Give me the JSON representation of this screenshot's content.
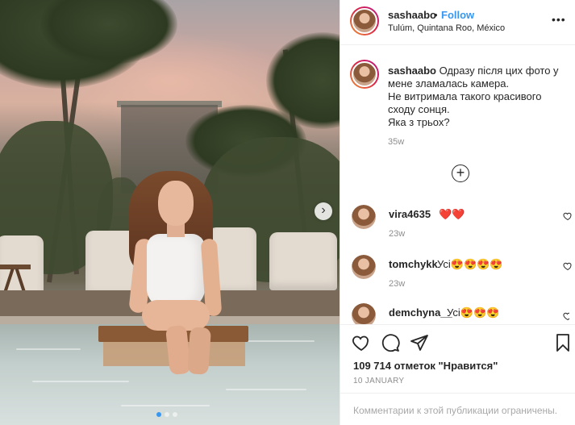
{
  "post": {
    "username": "sashaabo",
    "separator": "•",
    "follow_label": "Follow",
    "location": "Tulúm, Quintana Roo, México",
    "more_label": "•••"
  },
  "caption": {
    "username": "sashaabo",
    "lines": [
      "Одразу після цих фото у",
      "мене зламалась камера.",
      "Не витримала такого красивого",
      "сходу сонця.",
      "Яка з трьох?"
    ],
    "time": "35w",
    "load_more_label": "+"
  },
  "comments": [
    {
      "username": "vira4635",
      "text": "❤️❤️",
      "time": "23w"
    },
    {
      "username": "tomchykk",
      "text": "Усі😍😍😍😍",
      "time": "23w"
    },
    {
      "username": "demchyna__",
      "text": "Усі😍😍😍",
      "time": ""
    }
  ],
  "actions": {
    "likes": "109 714 отметок \"Нравится\"",
    "date": "10 JANUARY",
    "comments_disabled": "Комментарии к этой публикации ограничены."
  },
  "carousel": {
    "next_label": "›",
    "slide_count": 3,
    "active_slide": 1
  },
  "colors": {
    "accent": "#3897f0",
    "text": "#262626",
    "muted": "#8e8e8e"
  }
}
